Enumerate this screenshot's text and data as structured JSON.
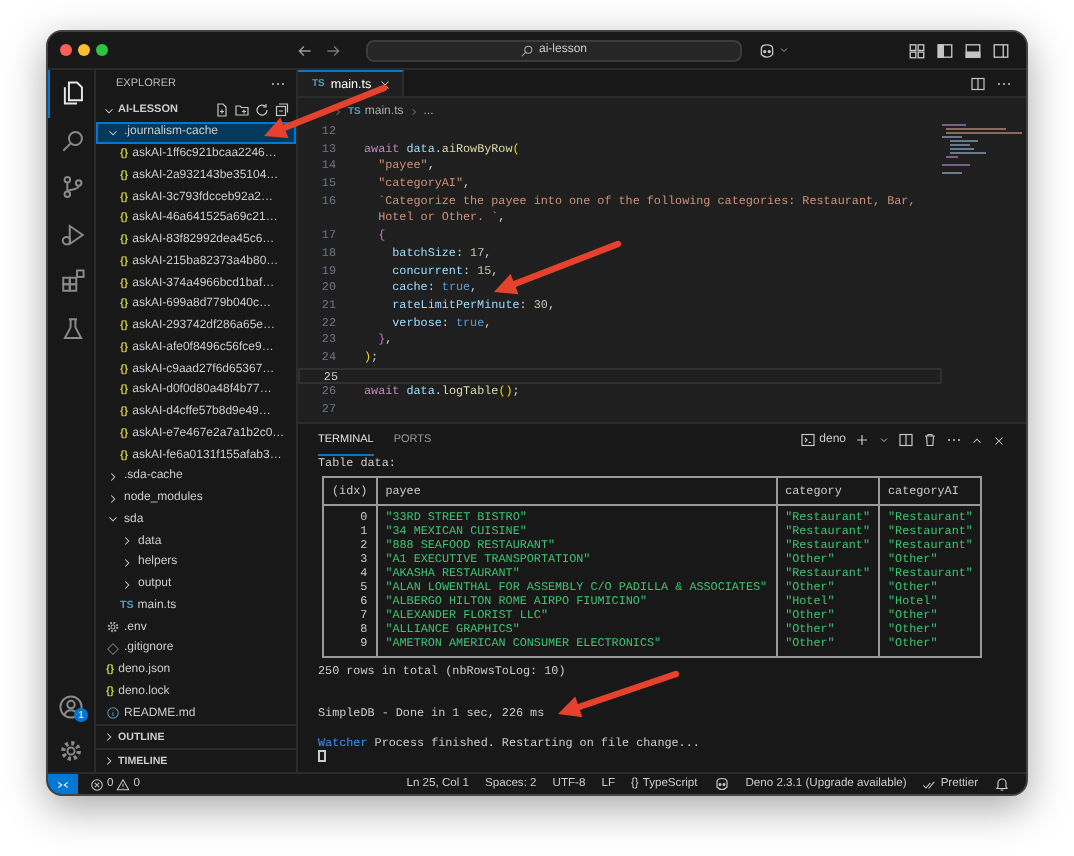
{
  "titlebar": {
    "search": "ai-lesson"
  },
  "activity_bar": {
    "items": [
      {
        "kind": "files",
        "selected": true
      },
      {
        "kind": "search",
        "selected": false
      },
      {
        "kind": "scm",
        "selected": false
      },
      {
        "kind": "run",
        "selected": false
      },
      {
        "kind": "extensions",
        "selected": false
      },
      {
        "kind": "flask",
        "selected": false
      }
    ],
    "account_badge": "1"
  },
  "sidebar": {
    "header": "EXPLORER",
    "root": {
      "label": "AI-LESSON",
      "expanded": true
    },
    "tree": [
      {
        "kind": "folder",
        "name": ".journalism-cache",
        "expanded": true,
        "selected": true,
        "children": [
          {
            "kind": "json",
            "badge": "{}",
            "name": "askAI-1ff6c921bcaa2246…",
            "selected": false
          },
          {
            "kind": "json",
            "badge": "{}",
            "name": "askAI-2a932143be35104…",
            "selected": false
          },
          {
            "kind": "json",
            "badge": "{}",
            "name": "askAI-3c793fdcceb92a2…",
            "selected": false
          },
          {
            "kind": "json",
            "badge": "{}",
            "name": "askAI-46a641525a69c21…",
            "selected": false
          },
          {
            "kind": "json",
            "badge": "{}",
            "name": "askAI-83f82992dea45c6…",
            "selected": false
          },
          {
            "kind": "json",
            "badge": "{}",
            "name": "askAI-215ba82373a4b80…",
            "selected": false
          },
          {
            "kind": "json",
            "badge": "{}",
            "name": "askAI-374a4966bcd1baf…",
            "selected": false
          },
          {
            "kind": "json",
            "badge": "{}",
            "name": "askAI-699a8d779b040c…",
            "selected": false
          },
          {
            "kind": "json",
            "badge": "{}",
            "name": "askAI-293742df286a65e…",
            "selected": false
          },
          {
            "kind": "json",
            "badge": "{}",
            "name": "askAI-afe0f8496c56fce9…",
            "selected": false
          },
          {
            "kind": "json",
            "badge": "{}",
            "name": "askAI-c9aad27f6d65367…",
            "selected": false
          },
          {
            "kind": "json",
            "badge": "{}",
            "name": "askAI-d0f0d80a48f4b77…",
            "selected": false
          },
          {
            "kind": "json",
            "badge": "{}",
            "name": "askAI-d4cffe57b8d9e49…",
            "selected": false
          },
          {
            "kind": "json",
            "badge": "{}",
            "name": "askAI-e7e467e2a7a1b2c0…",
            "selected": false
          },
          {
            "kind": "json",
            "badge": "{}",
            "name": "askAI-fe6a0131f155afab3…",
            "selected": false
          }
        ]
      },
      {
        "kind": "folder",
        "name": ".sda-cache",
        "expanded": false,
        "selected": false
      },
      {
        "kind": "folder",
        "name": "node_modules",
        "expanded": false,
        "selected": false
      },
      {
        "kind": "folder",
        "name": "sda",
        "expanded": true,
        "selected": false,
        "children": [
          {
            "kind": "folder",
            "name": "data",
            "expanded": false,
            "selected": false
          },
          {
            "kind": "folder",
            "name": "helpers",
            "expanded": false,
            "selected": false
          },
          {
            "kind": "folder",
            "name": "output",
            "expanded": false,
            "selected": false
          },
          {
            "kind": "ts",
            "badge": "TS",
            "name": "main.ts",
            "selected": false
          }
        ]
      },
      {
        "kind": "env",
        "name": ".env",
        "selected": false
      },
      {
        "kind": "git",
        "name": ".gitignore",
        "selected": false
      },
      {
        "kind": "json",
        "badge": "{}",
        "name": "deno.json",
        "selected": false
      },
      {
        "kind": "json",
        "badge": "{}",
        "name": "deno.lock",
        "selected": false
      },
      {
        "kind": "info",
        "name": "README.md",
        "selected": false
      }
    ],
    "sections": [
      {
        "label": "OUTLINE",
        "expanded": false
      },
      {
        "label": "TIMELINE",
        "expanded": false
      }
    ]
  },
  "tabs": [
    {
      "badge": "TS",
      "label": "main.ts",
      "selected": true
    }
  ],
  "breadcrumbs": [
    {
      "badge": "TS",
      "label": "main.ts"
    },
    {
      "label": "..."
    }
  ],
  "code": [
    {
      "number": "12",
      "current": false
    },
    {
      "number": "13",
      "current": false,
      "tokens": [
        {
          "kind": "keyword",
          "text": "await "
        },
        {
          "kind": "variable",
          "text": "data"
        },
        {
          "kind": "punct",
          "text": "."
        },
        {
          "kind": "function",
          "text": "aiRowByRow"
        },
        {
          "kind": "bracket",
          "text": "("
        }
      ]
    },
    {
      "number": "14",
      "current": false,
      "tokens": [
        {
          "kind": "string",
          "text": "  \"payee\""
        },
        {
          "kind": "punct",
          "text": ","
        }
      ]
    },
    {
      "number": "15",
      "current": false,
      "tokens": [
        {
          "kind": "string",
          "text": "  \"categoryAI\""
        },
        {
          "kind": "punct",
          "text": ","
        }
      ]
    },
    {
      "number": "16",
      "current": false,
      "tokens": [
        {
          "kind": "string",
          "text": "  `Categorize the payee into one of the following categories: Restaurant, Bar,"
        }
      ]
    },
    {
      "current": false,
      "tokens": [
        {
          "kind": "string",
          "text": "  Hotel or Other. `"
        },
        {
          "kind": "punct",
          "text": ","
        }
      ]
    },
    {
      "number": "17",
      "current": false,
      "tokens": [
        {
          "kind": "brace",
          "text": "  {"
        }
      ]
    },
    {
      "number": "18",
      "current": false,
      "tokens": [
        {
          "kind": "variable",
          "text": "    batchSize"
        },
        {
          "kind": "punct",
          "text": ": "
        },
        {
          "kind": "number",
          "text": "17"
        },
        {
          "kind": "punct",
          "text": ","
        }
      ]
    },
    {
      "number": "19",
      "current": false,
      "tokens": [
        {
          "kind": "variable",
          "text": "    concurrent"
        },
        {
          "kind": "punct",
          "text": ": "
        },
        {
          "kind": "number",
          "text": "15"
        },
        {
          "kind": "punct",
          "text": ","
        }
      ]
    },
    {
      "number": "20",
      "current": false,
      "tokens": [
        {
          "kind": "variable",
          "text": "    cache"
        },
        {
          "kind": "punct",
          "text": ": "
        },
        {
          "kind": "boolean",
          "text": "true"
        },
        {
          "kind": "punct",
          "text": ","
        }
      ]
    },
    {
      "number": "21",
      "current": false,
      "tokens": [
        {
          "kind": "variable",
          "text": "    rateLimitPerMinute"
        },
        {
          "kind": "punct",
          "text": ": "
        },
        {
          "kind": "number",
          "text": "30"
        },
        {
          "kind": "punct",
          "text": ","
        }
      ]
    },
    {
      "number": "22",
      "current": false,
      "tokens": [
        {
          "kind": "variable",
          "text": "    verbose"
        },
        {
          "kind": "punct",
          "text": ": "
        },
        {
          "kind": "boolean",
          "text": "true"
        },
        {
          "kind": "punct",
          "text": ","
        }
      ]
    },
    {
      "number": "23",
      "current": false,
      "tokens": [
        {
          "kind": "brace",
          "text": "  }"
        },
        {
          "kind": "punct",
          "text": ","
        }
      ]
    },
    {
      "number": "24",
      "current": false,
      "tokens": [
        {
          "kind": "bracket",
          "text": ")"
        },
        {
          "kind": "punct",
          "text": ";"
        }
      ]
    },
    {
      "number": "25",
      "current": true
    },
    {
      "number": "26",
      "current": false,
      "tokens": [
        {
          "kind": "keyword",
          "text": "await "
        },
        {
          "kind": "variable",
          "text": "data"
        },
        {
          "kind": "punct",
          "text": "."
        },
        {
          "kind": "function",
          "text": "logTable"
        },
        {
          "kind": "bracket",
          "text": "()"
        },
        {
          "kind": "punct",
          "text": ";"
        }
      ]
    },
    {
      "number": "27",
      "current": false
    }
  ],
  "terminal": {
    "tabs": [
      {
        "label": "TERMINAL",
        "selected": true
      },
      {
        "label": "PORTS",
        "selected": false
      }
    ],
    "shell": "deno",
    "table": {
      "columns": [
        "(idx)",
        "payee",
        "category",
        "categoryAI"
      ],
      "rows": [
        [
          "0",
          "\"33RD STREET BISTRO\"",
          "\"Restaurant\"",
          "\"Restaurant\""
        ],
        [
          "1",
          "\"34 MEXICAN CUISINE\"",
          "\"Restaurant\"",
          "\"Restaurant\""
        ],
        [
          "2",
          "\"888 SEAFOOD RESTAURANT\"",
          "\"Restaurant\"",
          "\"Restaurant\""
        ],
        [
          "3",
          "\"A1 EXECUTIVE TRANSPORTATION\"",
          "\"Other\"",
          "\"Other\""
        ],
        [
          "4",
          "\"AKASHA RESTAURANT\"",
          "\"Restaurant\"",
          "\"Restaurant\""
        ],
        [
          "5",
          "\"ALAN LOWENTHAL FOR ASSEMBLY C/O PADILLA & ASSOCIATES\"",
          "\"Other\"",
          "\"Other\""
        ],
        [
          "6",
          "\"ALBERGO HILTON ROME AIRPO FIUMICINO\"",
          "\"Hotel\"",
          "\"Hotel\""
        ],
        [
          "7",
          "\"ALEXANDER FLORIST LLC\"",
          "\"Other\"",
          "\"Other\""
        ],
        [
          "8",
          "\"ALLIANCE GRAPHICS\"",
          "\"Other\"",
          "\"Other\""
        ],
        [
          "9",
          "\"AMETRON AMERICAN CONSUMER ELECTRONICS\"",
          "\"Other\"",
          "\"Other\""
        ]
      ]
    },
    "lines": [
      {
        "kind": "text",
        "text": "Table data:"
      },
      {
        "kind": "table"
      },
      {
        "kind": "text",
        "text": "250 rows in total (nbRowsToLog: 10)"
      },
      {
        "kind": "blank"
      },
      {
        "kind": "blank"
      },
      {
        "kind": "text",
        "text": "SimpleDB - Done in 1 sec, 226 ms"
      },
      {
        "kind": "blank"
      },
      {
        "kind": "watcher",
        "label": "Watcher",
        "text": "Process finished. Restarting on file change..."
      },
      {
        "kind": "cursor"
      }
    ]
  },
  "status_bar": {
    "errors": "0",
    "warnings": "0",
    "items": [
      {
        "kind": "text",
        "label": "Ln 25, Col 1"
      },
      {
        "kind": "text",
        "label": "Spaces: 2"
      },
      {
        "kind": "text",
        "label": "UTF-8"
      },
      {
        "kind": "text",
        "label": "LF"
      },
      {
        "kind": "badge",
        "badge": "{}",
        "label": "TypeScript"
      },
      {
        "kind": "copilot"
      },
      {
        "kind": "text",
        "label": "Deno 2.3.1 (Upgrade available)"
      },
      {
        "kind": "check",
        "label": "Prettier"
      },
      {
        "kind": "bell"
      }
    ]
  }
}
